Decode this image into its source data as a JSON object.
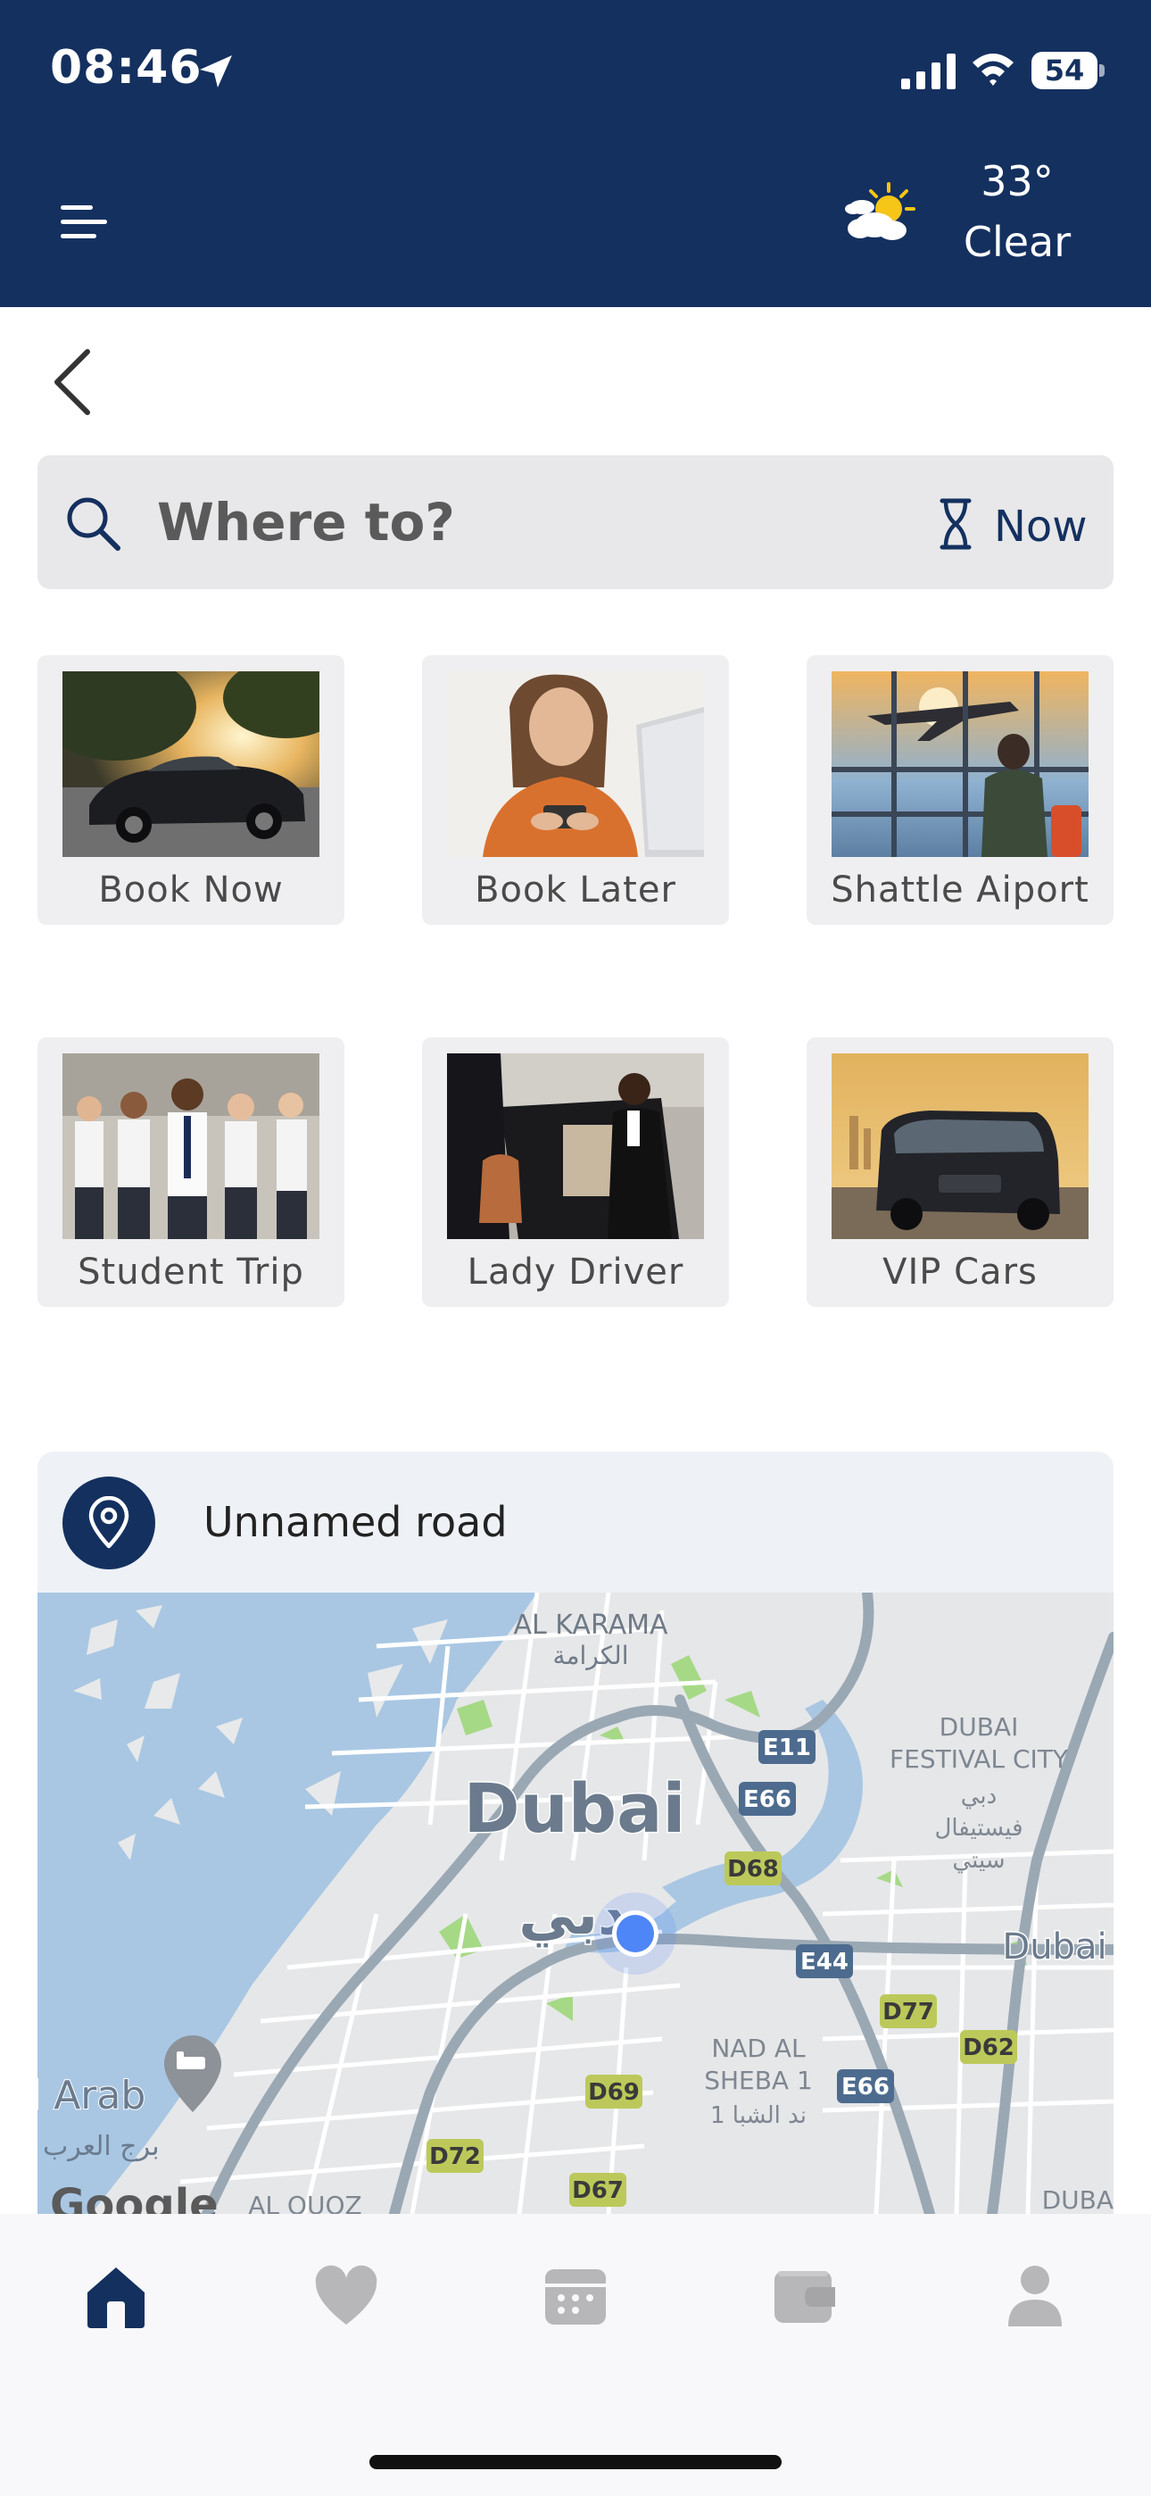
{
  "status_bar": {
    "time": "08:46",
    "battery": "54"
  },
  "header": {
    "weather_temp": "33°",
    "weather_condition": "Clear"
  },
  "search": {
    "placeholder": "Where to?",
    "time_option": "Now"
  },
  "services": [
    {
      "label": "Book Now"
    },
    {
      "label": "Book Later"
    },
    {
      "label": "Shattle Aiport"
    },
    {
      "label": "Student Trip"
    },
    {
      "label": "Lady Driver"
    },
    {
      "label": "VIP Cars"
    }
  ],
  "location": {
    "address": "Unnamed road"
  },
  "map": {
    "labels": {
      "city": "Dubai",
      "city_ar": "دبي",
      "al_karama": "AL KARAMA",
      "al_karama_ar": "الكرامة",
      "festival_1": "DUBAI",
      "festival_2": "FESTIVAL CITY",
      "festival_ar_1": "دبي",
      "festival_ar_2": "فيستيفال",
      "festival_ar_3": "سيتي",
      "nad_1": "NAD AL",
      "nad_2": "SHEBA 1",
      "nad_ar": "1 ند الشبا",
      "dubai_east": "Dubai",
      "al_arab": "l Arab",
      "al_arab_ar": "برج العرب",
      "google": "Google",
      "al_quoz": "AL QUOZ",
      "dubai_br": "DUBA"
    },
    "road_shields": [
      "E11",
      "E66",
      "D68",
      "E44",
      "D77",
      "D62",
      "E66",
      "D69",
      "D72",
      "D67"
    ]
  },
  "colors": {
    "primary": "#14305f",
    "water": "#a9c7e3",
    "park": "#a6d986",
    "nav_active": "#14305f",
    "nav_inactive": "#b7b7b9"
  },
  "nav": {
    "items": [
      "home-icon",
      "heart-icon",
      "calendar-icon",
      "wallet-icon",
      "profile-icon"
    ],
    "active_index": 0
  }
}
